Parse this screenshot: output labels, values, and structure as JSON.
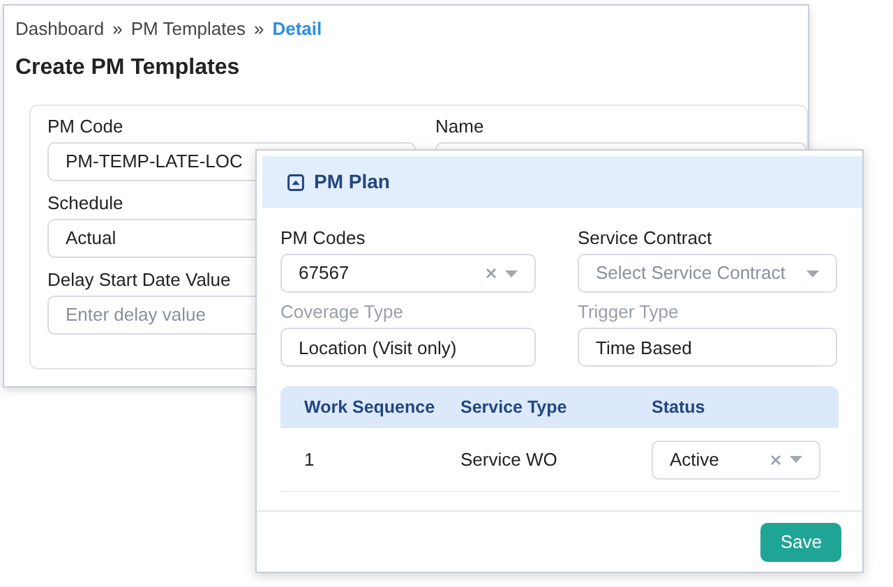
{
  "breadcrumb": [
    {
      "label": "Dashboard",
      "separator": "»",
      "current": false
    },
    {
      "label": "PM Templates",
      "separator": "»",
      "current": false
    },
    {
      "label": "Detail",
      "current": true
    }
  ],
  "page_title": "Create PM Templates",
  "template_form": {
    "fields": [
      {
        "label": "PM Code",
        "value": "PM-TEMP-LATE-LOC"
      },
      {
        "label": "Name"
      },
      {
        "label": "Schedule",
        "value": "Actual"
      },
      {
        "label": "Delay Start Date Value",
        "placeholder": "Enter delay value"
      }
    ]
  },
  "pm_plan": {
    "title": "PM Plan",
    "fields": [
      {
        "label": "PM Codes",
        "kind": "select",
        "value": "67567",
        "clearable": true,
        "disabled": false
      },
      {
        "label": "Service Contract",
        "kind": "select",
        "placeholder": "Select Service Contract",
        "clearable": false,
        "disabled": false
      },
      {
        "label": "Coverage Type",
        "kind": "text",
        "value": "Location (Visit only)",
        "disabled": true
      },
      {
        "label": "Trigger Type",
        "kind": "text",
        "value": "Time Based",
        "disabled": true
      }
    ],
    "table": {
      "columns": [
        "Work Sequence",
        "Service Type",
        "Status"
      ],
      "rows": [
        {
          "work_sequence": "1",
          "service_type": "Service WO",
          "status": {
            "value": "Active",
            "clearable": true
          }
        }
      ]
    },
    "save_button": "Save"
  }
}
